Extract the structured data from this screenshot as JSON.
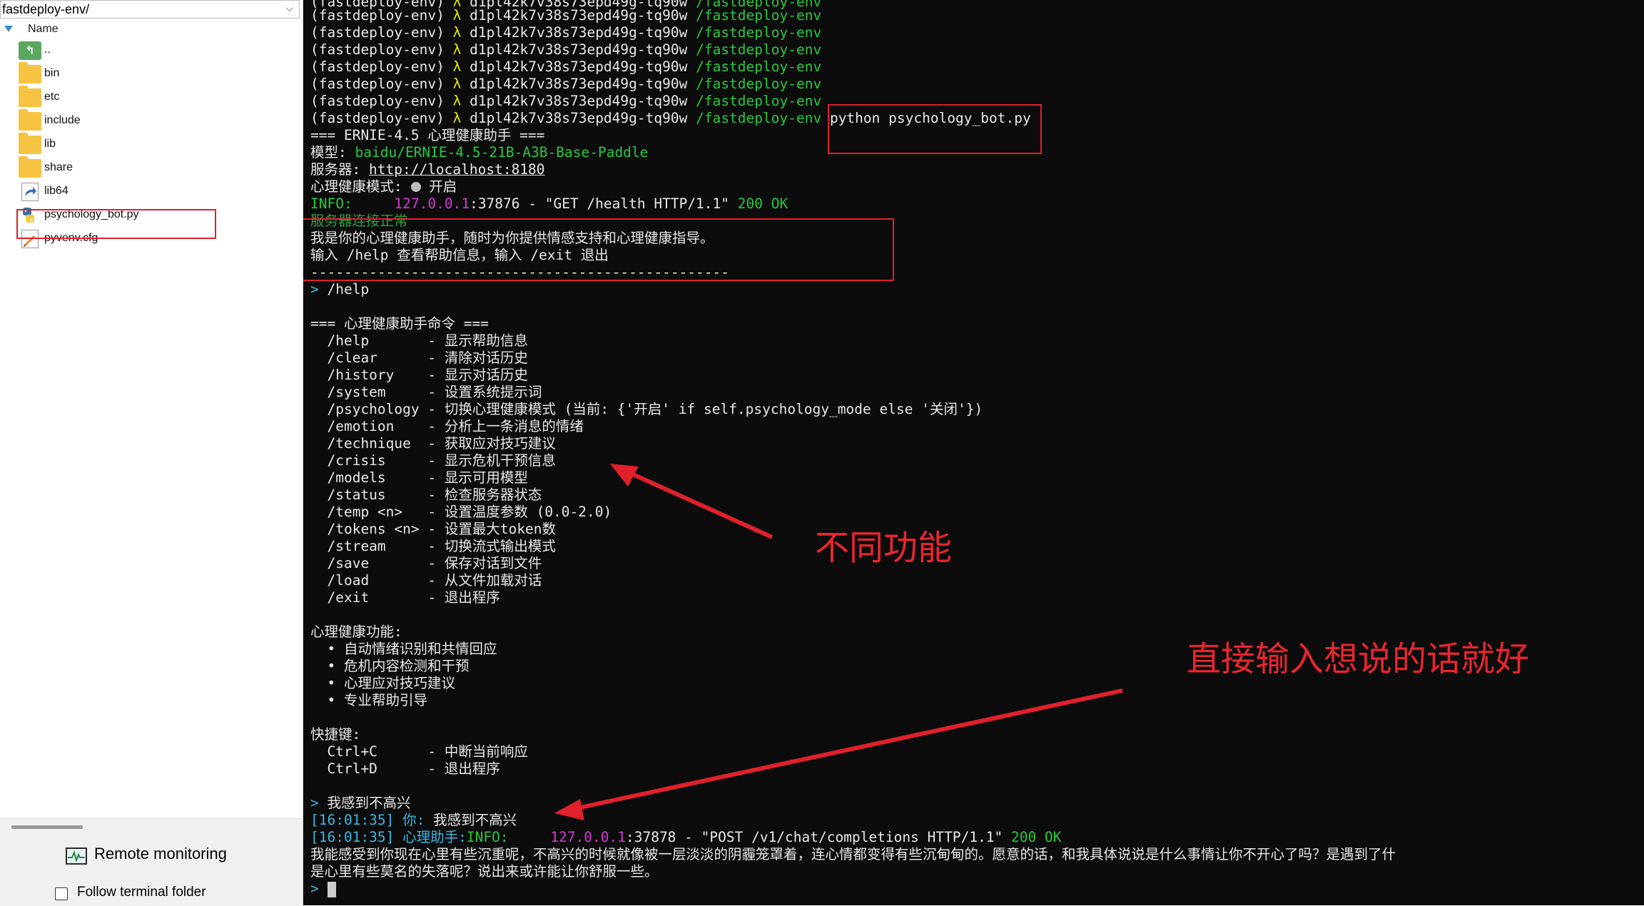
{
  "file_panel": {
    "path": "fastdeploy-env/",
    "column_header": "Name",
    "items": [
      {
        "name": "..",
        "icon": "up-folder-icon"
      },
      {
        "name": "bin",
        "icon": "folder-icon"
      },
      {
        "name": "etc",
        "icon": "folder-icon"
      },
      {
        "name": "include",
        "icon": "folder-icon"
      },
      {
        "name": "lib",
        "icon": "folder-icon"
      },
      {
        "name": "share",
        "icon": "folder-icon"
      },
      {
        "name": "lib64",
        "icon": "symlink-icon"
      },
      {
        "name": "psychology_bot.py",
        "icon": "python-file-icon"
      },
      {
        "name": "pyvenv.cfg",
        "icon": "config-file-icon"
      }
    ],
    "remote_monitoring": "Remote monitoring",
    "follow_terminal_folder": "Follow terminal folder"
  },
  "terminal": {
    "env": "(fastdeploy-env)",
    "lambda": "λ",
    "host": "d1pl42k7v38s73epd49g-tq90w",
    "cwd": "/fastdeploy-env",
    "command": "python psychology_bot.py",
    "banner": "=== ERNIE-4.5 心理健康助手 ===",
    "model_label": "模型:",
    "model_value": "baidu/ERNIE-4.5-21B-A3B-Base-Paddle",
    "server_label": "服务器:",
    "server_url": "http://localhost:8180",
    "mode_label": "心理健康模式:",
    "mode_value": "开启",
    "info_label": "INFO:",
    "health_ip": "127.0.0.1",
    "health_port": ":37876 - \"GET /health HTTP/1.1\"",
    "status_ok": "200 OK",
    "connect_ok": "服务器连接正常",
    "intro": "我是你的心理健康助手，随时为你提供情感支持和心理健康指导。",
    "help_hint": "输入 /help 查看帮助信息，输入 /exit 退出",
    "separator": "--------------------------------------------------",
    "prompt_char": ">",
    "help_cmd": "/help",
    "commands_title": "=== 心理健康助手命令 ===",
    "commands": [
      "  /help       - 显示帮助信息",
      "  /clear      - 清除对话历史",
      "  /history    - 显示对话历史",
      "  /system     - 设置系统提示词",
      "  /psychology - 切换心理健康模式 (当前: {'开启' if self.psychology_mode else '关闭'})",
      "  /emotion    - 分析上一条消息的情绪",
      "  /technique  - 获取应对技巧建议",
      "  /crisis     - 显示危机干预信息",
      "  /models     - 显示可用模型",
      "  /status     - 检查服务器状态",
      "  /temp <n>   - 设置温度参数 (0.0-2.0)",
      "  /tokens <n> - 设置最大token数",
      "  /stream     - 切换流式输出模式",
      "  /save       - 保存对话到文件",
      "  /load       - 从文件加载对话",
      "  /exit       - 退出程序"
    ],
    "features_title": "心理健康功能:",
    "features": [
      "  • 自动情绪识别和共情回应",
      "  • 危机内容检测和干预",
      "  • 心理应对技巧建议",
      "  • 专业帮助引导"
    ],
    "shortcuts_title": "快捷键:",
    "shortcuts": [
      "  Ctrl+C      - 中断当前响应",
      "  Ctrl+D      - 退出程序"
    ],
    "user_input": "我感到不高兴",
    "timestamp": "[16:01:35]",
    "you_label": "你:",
    "assistant_label": "心理助手:",
    "chat_port": ":37878 - \"POST /v1/chat/completions HTTP/1.1\"",
    "reply_line1": "我能感受到你现在心里有些沉重呢，不高兴的时候就像被一层淡淡的阴霾笼罩着，连心情都变得有些沉甸甸的。愿意的话，和我具体说说是什么事情让你不开心了吗？是遇到了什",
    "reply_line2": "是心里有些莫名的失落呢？说出来或许能让你舒服一些。"
  },
  "annotations": {
    "features_note": "不同功能",
    "input_note": "直接输入想说的话就好"
  },
  "colors": {
    "terminal_bg": "#0c0c0c",
    "prompt_green": "#27c93f",
    "lambda_yellow": "#e5e510",
    "ip_magenta": "#d239d2",
    "chat_cyan": "#3ab7e6",
    "annotation_red": "#e0212b"
  }
}
